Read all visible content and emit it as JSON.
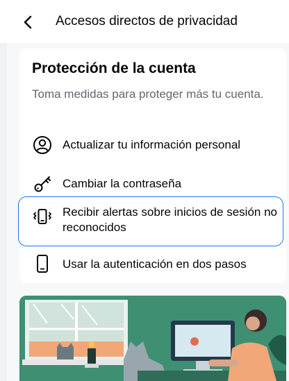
{
  "header": {
    "title": "Accesos directos de privacidad"
  },
  "card": {
    "title": "Protección de la cuenta",
    "subtitle": "Toma medidas para proteger más tu cuenta.",
    "items": [
      {
        "label": "Actualizar tu información personal",
        "icon": "user-circle-icon"
      },
      {
        "label": "Cambiar la contraseña",
        "icon": "key-icon"
      },
      {
        "label": "Recibir alertas sobre inicios de sesión no reconocidos",
        "icon": "vibrating-phone-icon"
      },
      {
        "label": "Usar la autenticación en dos pasos",
        "icon": "phone-icon"
      }
    ]
  },
  "colors": {
    "accent": "#1877f2",
    "illustration_bg": "#3f8f73"
  }
}
